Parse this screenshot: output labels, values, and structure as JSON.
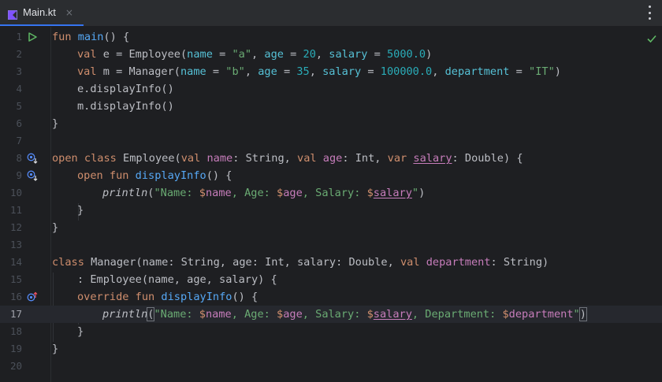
{
  "tab": {
    "label": "Main.kt",
    "close": "×"
  },
  "lines": [
    {
      "n": "1"
    },
    {
      "n": "2"
    },
    {
      "n": "3"
    },
    {
      "n": "4"
    },
    {
      "n": "5"
    },
    {
      "n": "6"
    },
    {
      "n": "7"
    },
    {
      "n": "8"
    },
    {
      "n": "9"
    },
    {
      "n": "10"
    },
    {
      "n": "11"
    },
    {
      "n": "12"
    },
    {
      "n": "13"
    },
    {
      "n": "14"
    },
    {
      "n": "15"
    },
    {
      "n": "16"
    },
    {
      "n": "17"
    },
    {
      "n": "18"
    },
    {
      "n": "19"
    },
    {
      "n": "20"
    }
  ],
  "code": {
    "l1": {
      "kw": "fun ",
      "fn": "main",
      "rest": "() {"
    },
    "l2": {
      "kw": "val ",
      "a": "e = Employee(",
      "p1": "name",
      "eq1": " = ",
      "s1": "\"a\"",
      "c1": ", ",
      "p2": "age",
      "eq2": " = ",
      "n1": "20",
      "c2": ", ",
      "p3": "salary",
      "eq3": " = ",
      "n2": "5000.0",
      "end": ")"
    },
    "l3": {
      "kw": "val ",
      "a": "m = Manager(",
      "p1": "name",
      "eq1": " = ",
      "s1": "\"b\"",
      "c1": ", ",
      "p2": "age",
      "eq2": " = ",
      "n1": "35",
      "c2": ", ",
      "p3": "salary",
      "eq3": " = ",
      "n2": "100000.0",
      "c3": ", ",
      "p4": "department",
      "eq4": " = ",
      "s2": "\"IT\"",
      "end": ")"
    },
    "l4": {
      "t": "e.displayInfo()"
    },
    "l5": {
      "t": "m.displayInfo()"
    },
    "l6": {
      "t": "}"
    },
    "l8": {
      "k1": "open class ",
      "a": "Employee(",
      "k2": "val ",
      "p1": "name",
      "b": ": String, ",
      "k3": "val ",
      "p2": "age",
      "c": ": Int, ",
      "k4": "var ",
      "p3": "salary",
      "d": ": Double) {"
    },
    "l9": {
      "kw": "open fun ",
      "fn": "displayInfo",
      "rest": "() {"
    },
    "l10": {
      "fn": "println",
      "a": "(",
      "s1": "\"Name: ",
      "t1": "$",
      "v1": "name",
      "s2": ", Age: ",
      "t2": "$",
      "v2": "age",
      "s3": ", Salary: ",
      "t3": "$",
      "v3": "salary",
      "s4": "\"",
      "end": ")"
    },
    "l11": {
      "t": "}"
    },
    "l12": {
      "t": "}"
    },
    "l14": {
      "kw": "class ",
      "a": "Manager(name: String, age: Int, salary: Double, ",
      "k2": "val ",
      "p1": "department",
      "b": ": String)"
    },
    "l15": {
      "t": ": Employee(name, age, salary) {"
    },
    "l16": {
      "kw": "override fun ",
      "fn": "displayInfo",
      "rest": "() {"
    },
    "l17": {
      "fn": "println",
      "a": "(",
      "s1": "\"Name: ",
      "t1": "$",
      "v1": "name",
      "s2": ", Age: ",
      "t2": "$",
      "v2": "age",
      "s3": ", Salary: ",
      "t3": "$",
      "v3": "salary",
      "s4": ", Department: ",
      "t4": "$",
      "v4": "department",
      "s5": "\"",
      "end": ")"
    },
    "l18": {
      "t": "}"
    },
    "l19": {
      "t": "}"
    }
  },
  "icons": {
    "run": "run-icon",
    "implemented": "implemented-icon",
    "override": "override-icon",
    "check": "no-problems-check-icon"
  }
}
